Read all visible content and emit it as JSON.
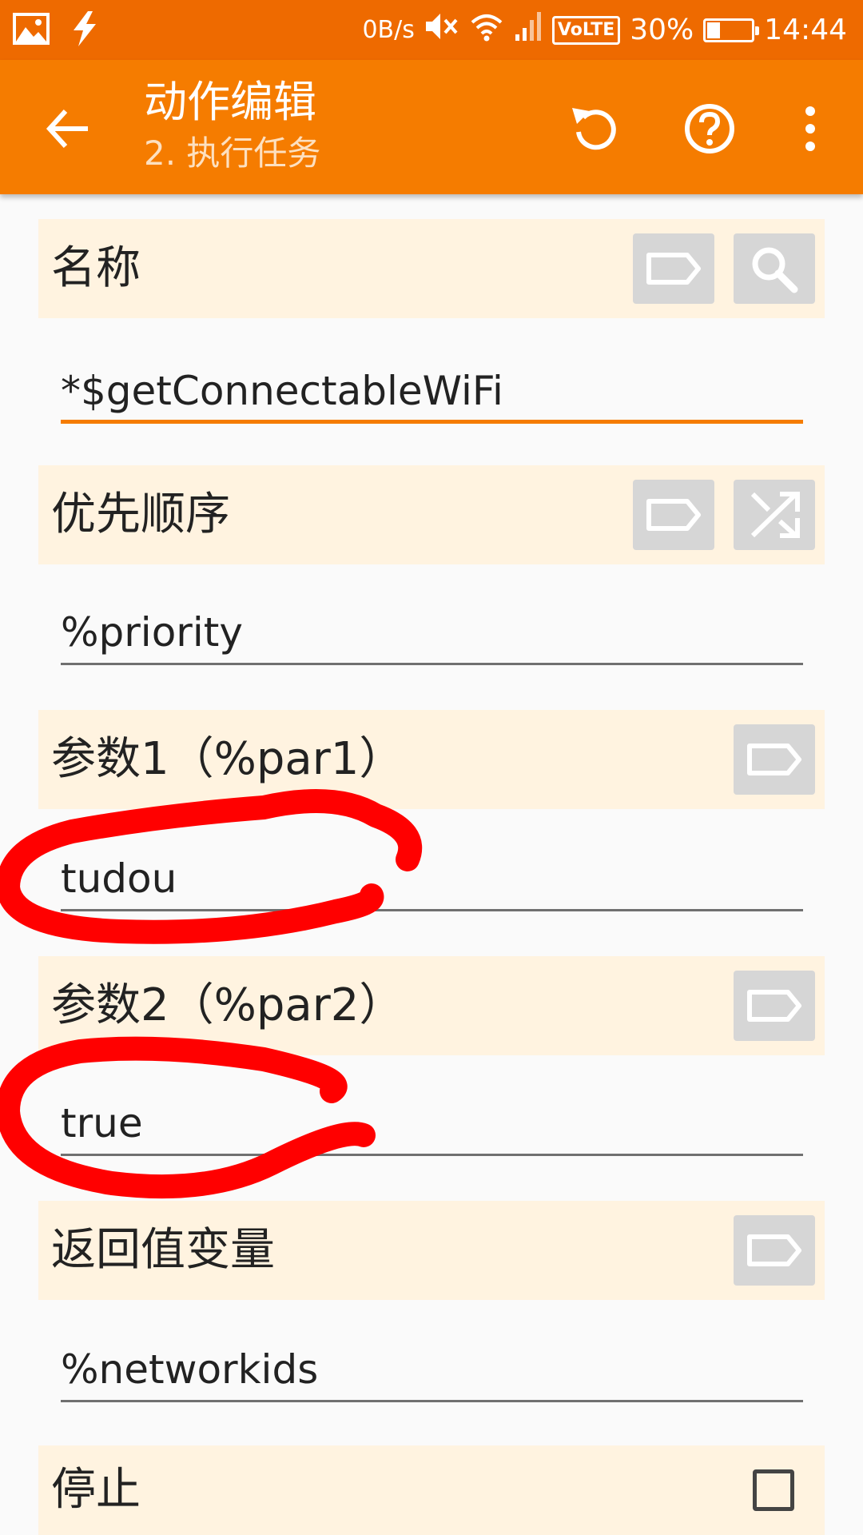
{
  "status_bar": {
    "net_speed": "0B/s",
    "volte": "VoLTE",
    "battery_percent": "30%",
    "battery_level": 0.3,
    "time": "14:44"
  },
  "app_bar": {
    "title": "动作编辑",
    "subtitle": "2. 执行任务"
  },
  "form": {
    "name_label": "名称",
    "name_value": "*$getConnectableWiFi",
    "priority_label": "优先顺序",
    "priority_value": "%priority",
    "param1_label": "参数1（%par1）",
    "param1_value": "tudou",
    "param2_label": "参数2（%par2）",
    "param2_value": "true",
    "return_label": "返回值变量",
    "return_value": "%networkids",
    "stop_label": "停止",
    "stop_checked": false
  },
  "colors": {
    "status_bar": "#ee6a00",
    "app_bar": "#f57c00",
    "section_bg": "#fff3e0",
    "annotation": "#ff0000"
  }
}
